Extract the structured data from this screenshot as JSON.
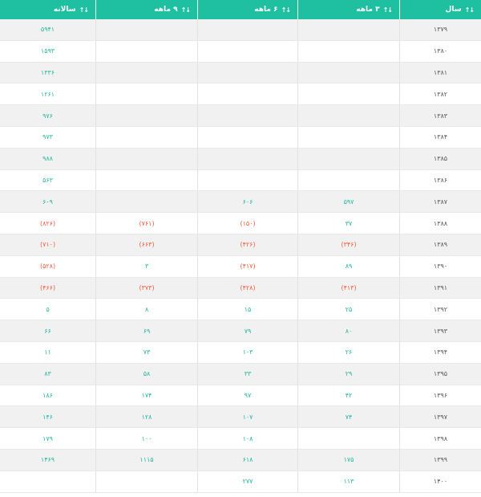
{
  "table": {
    "headers": [
      "سال",
      "۳ ماهه",
      "۶ ماهه",
      "۹ ماهه",
      "سالانه"
    ],
    "sort_icon": "sort-arrows-icon",
    "colors": {
      "header_bg": "#1fbfa2",
      "positive": "#23b59d",
      "negative": "#ef5a3c",
      "year": "#555555"
    },
    "rows": [
      [
        "۱۳۷۹",
        "",
        "",
        "",
        "۵۹۴۱"
      ],
      [
        "۱۳۸۰",
        "",
        "",
        "",
        "۱۵۹۳"
      ],
      [
        "۱۳۸۱",
        "",
        "",
        "",
        "۱۳۳۶"
      ],
      [
        "۱۳۸۲",
        "",
        "",
        "",
        "۱۲۶۱"
      ],
      [
        "۱۳۸۳",
        "",
        "",
        "",
        "۹۷۶"
      ],
      [
        "۱۳۸۴",
        "",
        "",
        "",
        "۹۷۳"
      ],
      [
        "۱۳۸۵",
        "",
        "",
        "",
        "۹۸۸"
      ],
      [
        "۱۳۸۶",
        "",
        "",
        "",
        "۵۶۳"
      ],
      [
        "۱۳۸۷",
        "۵۹۷",
        "۶۰۶",
        "",
        "۶۰۹"
      ],
      [
        "۱۳۸۸",
        "۳۷",
        "(۱۵۰)",
        "(۷۶۱)",
        "(۸۲۶)"
      ],
      [
        "۱۳۸۹",
        "(۳۴۶)",
        "(۴۲۶)",
        "(۶۶۳)",
        "(۷۱۰)"
      ],
      [
        "۱۳۹۰",
        "۸۹",
        "(۴۱۷)",
        "۳",
        "(۵۲۸)"
      ],
      [
        "۱۳۹۱",
        "(۴۱۳)",
        "(۴۲۸)",
        "(۳۷۳)",
        "(۴۶۶)"
      ],
      [
        "۱۳۹۲",
        "۲۵",
        "۱۵",
        "۸",
        "۵"
      ],
      [
        "۱۳۹۳",
        "۸۰",
        "۷۹",
        "۶۹",
        "۶۶"
      ],
      [
        "۱۳۹۴",
        "۲۶",
        "۱۰۳",
        "۷۳",
        "۱۱"
      ],
      [
        "۱۳۹۵",
        "۲۹",
        "۳۳",
        "۵۸",
        "۸۳"
      ],
      [
        "۱۳۹۶",
        "۴۲",
        "۹۷",
        "۱۷۴",
        "۱۸۶"
      ],
      [
        "۱۳۹۷",
        "۷۴",
        "۱۰۷",
        "۱۲۸",
        "۱۴۶"
      ],
      [
        "۱۳۹۸",
        "",
        "۱۰۸",
        "۱۰۰",
        "۱۷۹"
      ],
      [
        "۱۳۹۹",
        "۱۷۵",
        "۶۱۸",
        "۱۱۱۵",
        "۱۴۶۹"
      ],
      [
        "۱۴۰۰",
        "۱۱۳",
        "۲۷۷",
        "",
        ""
      ]
    ]
  }
}
